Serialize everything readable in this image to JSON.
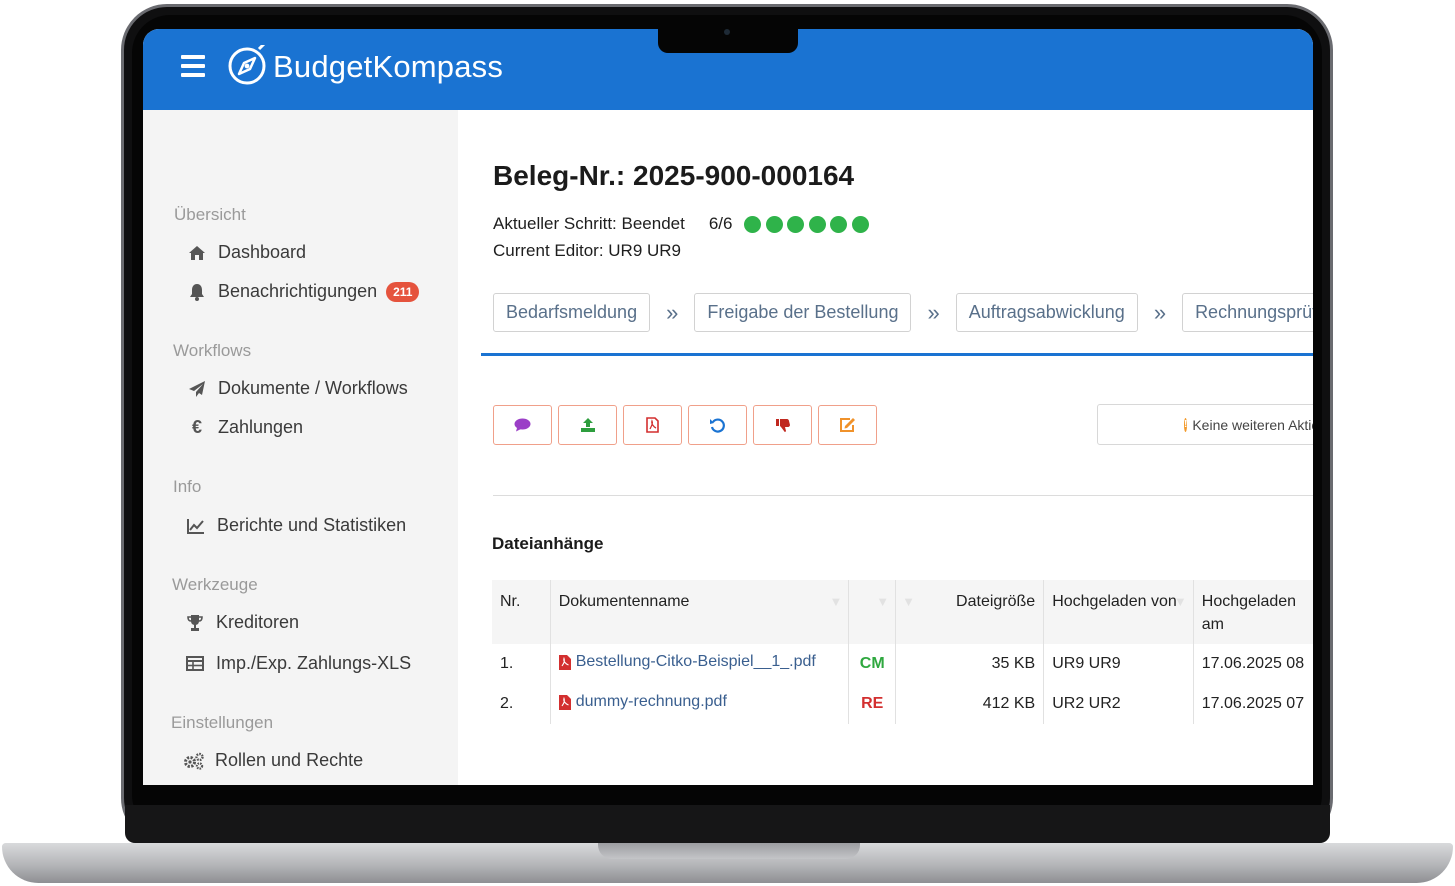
{
  "app": {
    "name": "BudgetKompass",
    "brand_color": "#1a73d2"
  },
  "sidebar": {
    "sections": [
      {
        "heading": "Übersicht",
        "items": [
          {
            "label": "Dashboard",
            "icon": "home-icon"
          },
          {
            "label": "Benachrichtigungen",
            "icon": "bell-icon",
            "badge": "211"
          }
        ]
      },
      {
        "heading": "Workflows",
        "items": [
          {
            "label": "Dokumente / Workflows",
            "icon": "paper-plane-icon"
          },
          {
            "label": "Zahlungen",
            "icon": "euro-icon"
          }
        ]
      },
      {
        "heading": "Info",
        "items": [
          {
            "label": "Berichte und Statistiken",
            "icon": "line-chart-icon"
          }
        ]
      },
      {
        "heading": "Werkzeuge",
        "items": [
          {
            "label": "Kreditoren",
            "icon": "trophy-icon"
          },
          {
            "label": "Imp./Exp. Zahlungs-XLS",
            "icon": "table-icon"
          }
        ]
      },
      {
        "heading": "Einstellungen",
        "items": [
          {
            "label": "Rollen und Rechte",
            "icon": "cogs-icon"
          }
        ]
      }
    ]
  },
  "document": {
    "title": "Beleg-Nr.: 2025-900-000164",
    "current_step": "Aktueller Schritt: Beendet",
    "step_count": "6/6",
    "completed_steps": 6,
    "editor": "Current Editor: UR9 UR9"
  },
  "workflow": {
    "steps": [
      "Bedarfsmeldung",
      "Freigabe der Bestellung",
      "Auftragsabwicklung",
      "Rechnungsprüfung"
    ],
    "separator": "»"
  },
  "actions": {
    "buttons": [
      {
        "icon": "comment-icon",
        "color": "#9b3fc7"
      },
      {
        "icon": "upload-icon",
        "color": "#2e9e3e"
      },
      {
        "icon": "pdf-icon",
        "color": "#d32f2f"
      },
      {
        "icon": "undo-icon",
        "color": "#1a73d2"
      },
      {
        "icon": "thumbs-down-icon",
        "color": "#c0281f"
      },
      {
        "icon": "edit-icon",
        "color": "#f0922b"
      }
    ],
    "info_text": "Keine weiteren Aktionen"
  },
  "attachments": {
    "title": "Dateianhänge",
    "columns": [
      "Nr.",
      "Dokumentenname",
      "",
      "Dateigröße",
      "Hochgeladen von",
      "Hochgeladen am"
    ],
    "rows": [
      {
        "nr": "1.",
        "name": "Bestellung-Citko-Beispiel__1_.pdf",
        "tag": "CM",
        "tag_color": "#2fa83f",
        "size": "35 KB",
        "uploader": "UR9 UR9",
        "date": "17.06.2025 08"
      },
      {
        "nr": "2.",
        "name": "dummy-rechnung.pdf",
        "tag": "RE",
        "tag_color": "#d32f2f",
        "size": "412 KB",
        "uploader": "UR2 UR2",
        "date": "17.06.2025 07"
      }
    ]
  }
}
